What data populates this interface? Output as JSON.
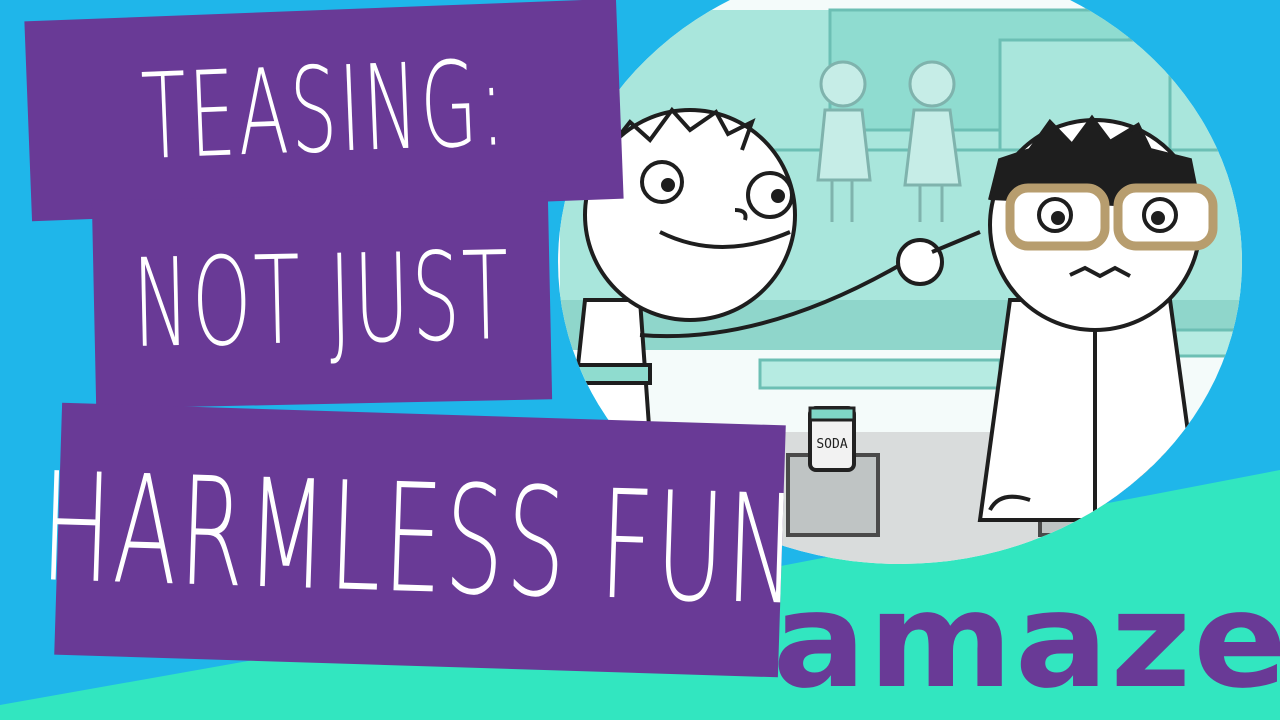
{
  "title": {
    "line1": "TEASING:",
    "line2": "NOT JUST",
    "line3": "HARMLESS FUN"
  },
  "illustration": {
    "can_label": "SODA"
  },
  "brand": {
    "logo_text": "amaze"
  },
  "colors": {
    "background_blue": "#1fb6ea",
    "banner_purple": "#693a96",
    "accent_mint": "#32e6c0",
    "scene_teal": "#9fe3d9",
    "text_white": "#ffffff"
  }
}
